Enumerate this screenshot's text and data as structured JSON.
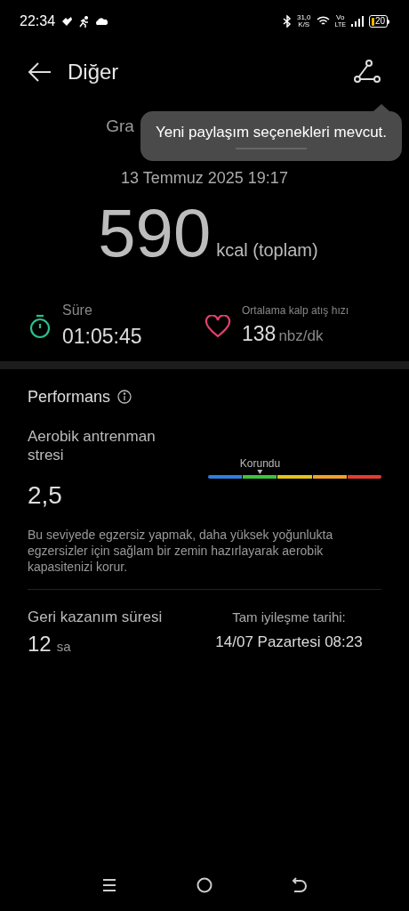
{
  "status_bar": {
    "time": "22:34",
    "speed_value": "31,0",
    "speed_unit": "K/S",
    "volte_top": "Vo",
    "volte_bottom": "LTE",
    "battery": "20"
  },
  "header": {
    "title": "Diğer"
  },
  "subtitle_partial": "Gra",
  "tooltip": {
    "text": "Yeni paylaşım seçenekleri mevcut."
  },
  "date": "13 Temmuz 2025 19:17",
  "calories": {
    "value": "590",
    "unit": "kcal (toplam)"
  },
  "stats": [
    {
      "kind": "timer",
      "label": "Süre",
      "value": "01:05:45"
    },
    {
      "kind": "heart",
      "label": "Ortalama kalp atış hızı",
      "value": "138",
      "unit": "nbz/dk"
    }
  ],
  "performance": {
    "title": "Performans",
    "stress_label": "Aerobik antrenman stresi",
    "stress_value": "2,5",
    "scale_label": "Korundu",
    "segments": [
      {
        "color": "#2f7fe0"
      },
      {
        "color": "#3fc23f"
      },
      {
        "color": "#e3c419"
      },
      {
        "color": "#f0a02a"
      },
      {
        "color": "#e83a32"
      }
    ],
    "description": "Bu seviyede egzersiz yapmak, daha yüksek yoğunlukta egzersizler için sağlam bir zemin hazırlayarak aerobik kapasitenizi korur.",
    "recovery_label": "Geri kazanım süresi",
    "recovery_value": "12",
    "recovery_unit": "sa",
    "full_recovery_label": "Tam iyileşme tarihi:",
    "full_recovery_value": "14/07 Pazartesi 08:23"
  }
}
